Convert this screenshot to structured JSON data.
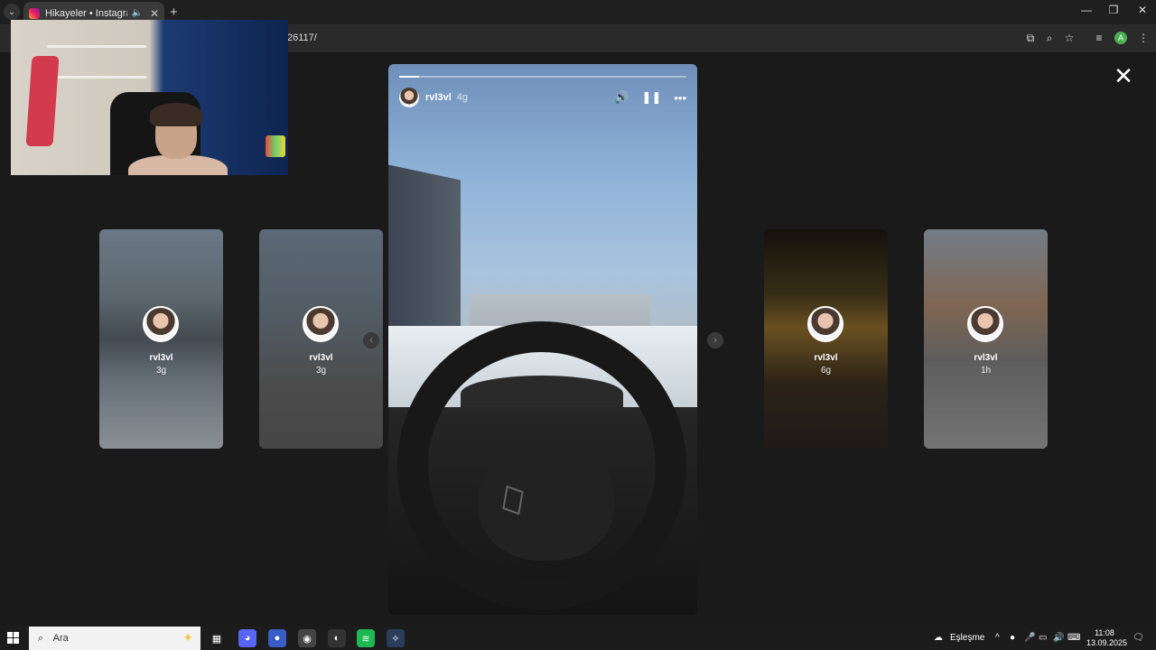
{
  "browser": {
    "tab_title": "Hikayeler • Instagram",
    "url_fragment": "26117/",
    "profile_initial": "A",
    "icons": [
      "tab-list-icon",
      "mute-icon",
      "close-icon",
      "new-tab-icon",
      "minimize-icon",
      "restore-icon",
      "close-window-icon",
      "cast-icon",
      "zoom-icon",
      "star-icon",
      "reading-list-icon",
      "menu-icon"
    ]
  },
  "story": {
    "username": "rvl3vl",
    "time": "4g",
    "progress": 0.07,
    "controls": [
      "volume-icon",
      "pause-icon",
      "more-icon"
    ]
  },
  "side_stories": [
    {
      "username": "rvl3vl",
      "age": "3g"
    },
    {
      "username": "rvl3vl",
      "age": "3g"
    },
    {
      "username": "rvl3vl",
      "age": "6g"
    },
    {
      "username": "rvl3vl",
      "age": "1h"
    }
  ],
  "taskbar": {
    "search_placeholder": "Ara",
    "weather_label": "Eşleşme",
    "time": "11:08",
    "date": "13.09.2025"
  },
  "colors": {
    "page_bg": "#1a1a1a",
    "progress_fill": "#ffffff",
    "profile_badge": "#4caf50"
  }
}
